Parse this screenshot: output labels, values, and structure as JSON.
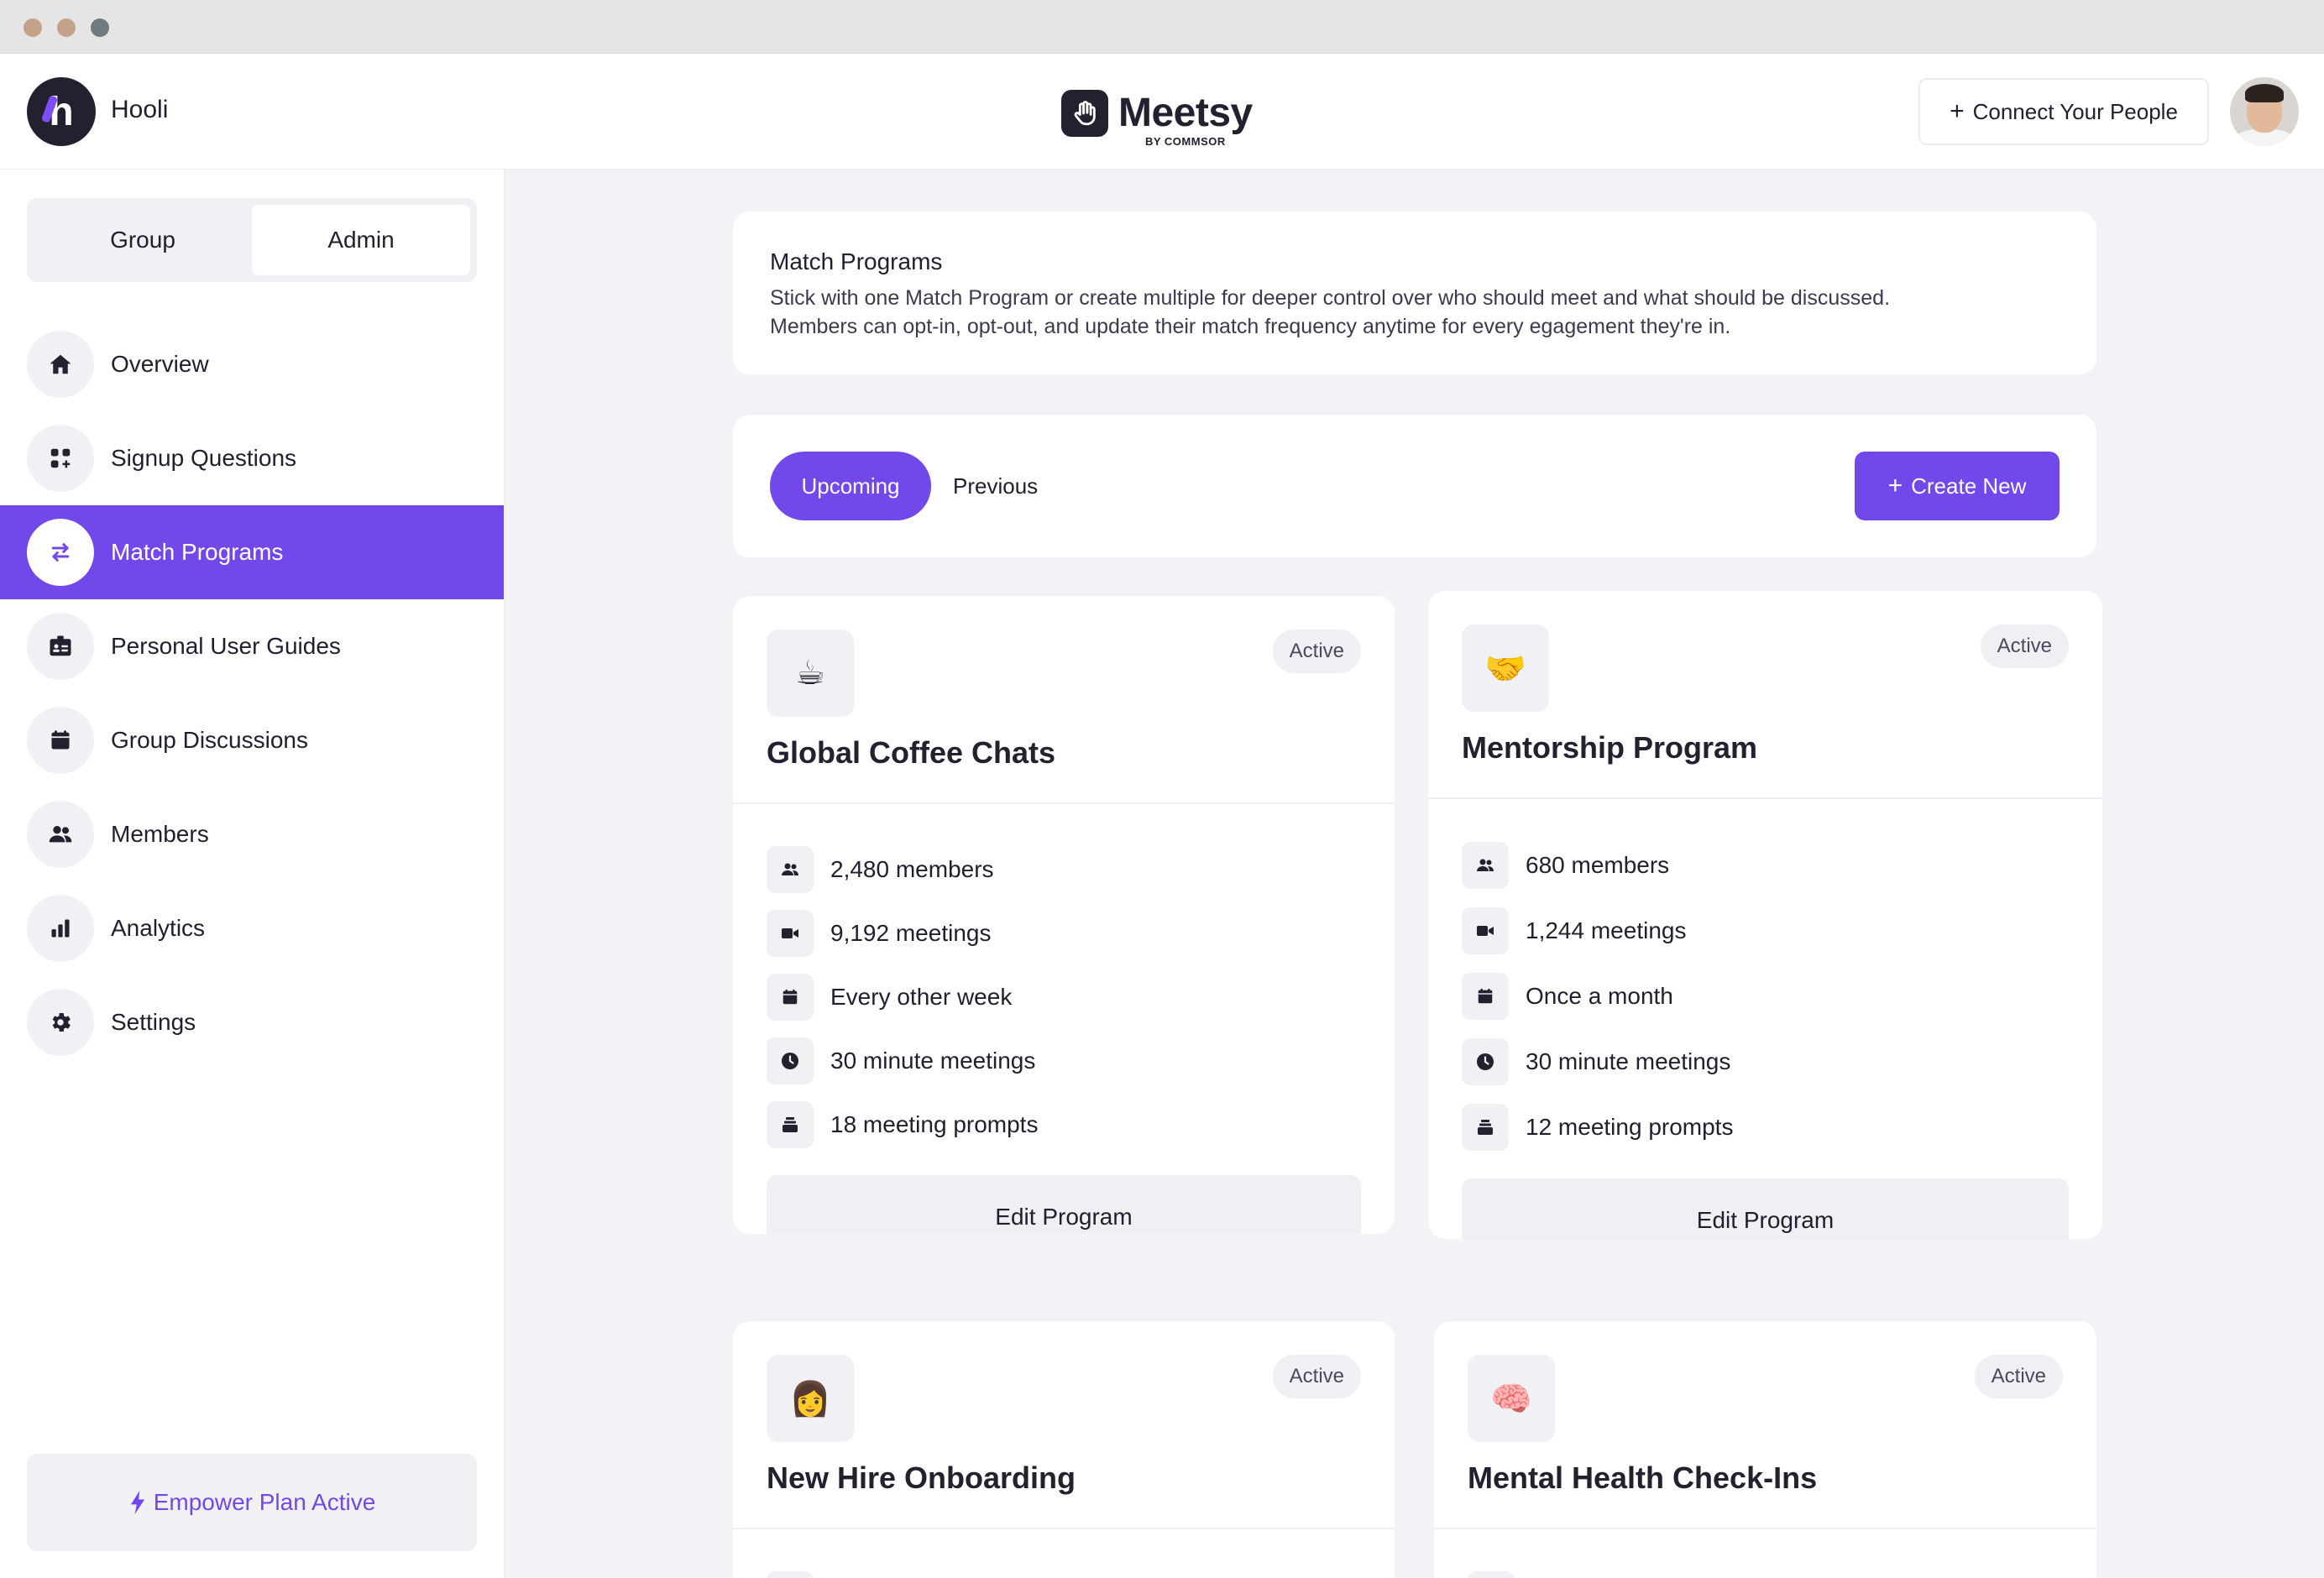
{
  "org": {
    "name": "Hooli",
    "logo_letter": "h"
  },
  "brand": {
    "name": "Meetsy",
    "sub": "BY COMMSOR"
  },
  "header": {
    "connect_label": "Connect Your People"
  },
  "sidebar": {
    "segments": [
      {
        "label": "Group"
      },
      {
        "label": "Admin",
        "selected": true
      }
    ],
    "items": [
      {
        "label": "Overview",
        "icon": "home-icon"
      },
      {
        "label": "Signup Questions",
        "icon": "grid-plus-icon"
      },
      {
        "label": "Match Programs",
        "icon": "swap-arrows-icon",
        "active": true
      },
      {
        "label": "Personal User Guides",
        "icon": "id-card-icon"
      },
      {
        "label": "Group Discussions",
        "icon": "calendar-icon"
      },
      {
        "label": "Members",
        "icon": "people-icon"
      },
      {
        "label": "Analytics",
        "icon": "bar-chart-icon"
      },
      {
        "label": "Settings",
        "icon": "gear-icon"
      }
    ],
    "plan_label": "Empower Plan Active"
  },
  "intro": {
    "title": "Match Programs",
    "line1": "Stick with one Match Program or create multiple for deeper control over who should meet and what should be discussed.",
    "line2": "Members can opt-in, opt-out, and update their match frequency anytime for every egagement they're in."
  },
  "tabs": {
    "upcoming": "Upcoming",
    "previous": "Previous",
    "create": "Create New"
  },
  "colors": {
    "accent": "#7348ea",
    "background": "#f2f2f7",
    "dark": "#23212f"
  },
  "programs": [
    {
      "title": "Global Coffee Chats",
      "emoji": "☕",
      "status": "Active",
      "members": "2,480 members",
      "meetings": "9,192 meetings",
      "frequency": "Every other week",
      "duration": "30 minute meetings",
      "prompts": "18 meeting prompts",
      "edit": "Edit Program"
    },
    {
      "title": "Mentorship Program",
      "emoji": "🤝",
      "status": "Active",
      "members": "680 members",
      "meetings": "1,244 meetings",
      "frequency": "Once a month",
      "duration": "30 minute meetings",
      "prompts": "12 meeting prompts",
      "edit": "Edit Program"
    },
    {
      "title": "New Hire Onboarding",
      "emoji": "👩",
      "status": "Active"
    },
    {
      "title": "Mental Health Check-Ins",
      "emoji": "🧠",
      "status": "Active"
    }
  ]
}
